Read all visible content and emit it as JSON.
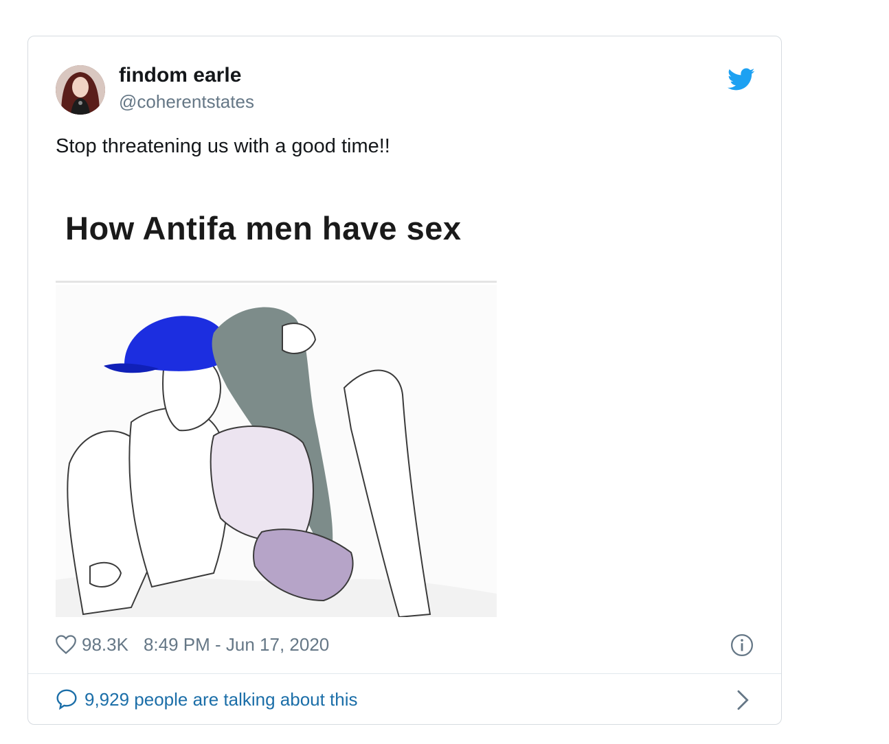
{
  "tweet": {
    "display_name": "findom earle",
    "handle": "@coherentstates",
    "text": "Stop threatening us with a good time!!",
    "likes": "98.3K",
    "timestamp": "8:49 PM - Jun 17, 2020",
    "talking": "9,929 people are talking about this"
  },
  "media": {
    "caption": "How Antifa men have sex"
  },
  "colors": {
    "twitter_blue": "#1da1f2",
    "link_blue": "#1b6ea8",
    "muted": "#657786"
  }
}
